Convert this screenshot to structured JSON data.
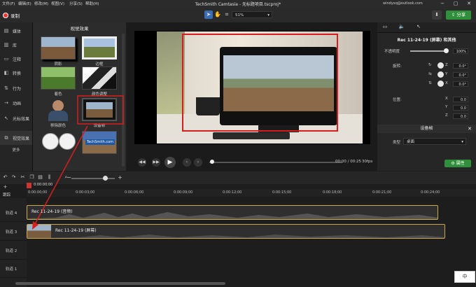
{
  "menu": [
    "文件(F)",
    "编辑(E)",
    "修改(M)",
    "视图(V)",
    "分享(S)",
    "帮助(H)"
  ],
  "app_title": "TechSmith Camtasia - 无标题项目.tscproj*",
  "account": "windyxq@outlook.com",
  "window_controls": [
    "−",
    "▢",
    "✕"
  ],
  "toolbar": {
    "record_label": "录制",
    "zoom_value": "51%",
    "share_label": "分享",
    "download_icon": "download-icon"
  },
  "sidebar": {
    "items": [
      {
        "icon": "film-icon",
        "label": "媒体"
      },
      {
        "icon": "library-icon",
        "label": "库"
      },
      {
        "icon": "annotation-icon",
        "label": "注释"
      },
      {
        "icon": "transition-icon",
        "label": "转换"
      },
      {
        "icon": "behavior-icon",
        "label": "行为"
      },
      {
        "icon": "animation-icon",
        "label": "动画"
      },
      {
        "icon": "cursor-effect-icon",
        "label": "光标效果"
      },
      {
        "icon": "visual-effects-icon",
        "label": "视觉效果"
      }
    ],
    "more": "更多"
  },
  "effects_panel": {
    "title": "视觉效果",
    "tiles": [
      {
        "label": "阴影"
      },
      {
        "label": "边框"
      },
      {
        "label": "着色"
      },
      {
        "label": "颜色调整"
      },
      {
        "label": "移除颜色"
      },
      {
        "label": "设备帧"
      },
      {
        "label": ""
      },
      {
        "label": ""
      }
    ],
    "techsmith_badge": "TechSmith.com"
  },
  "player": {
    "timecode": "00:00 / 00:25",
    "fps": "30fps"
  },
  "properties": {
    "clip_name": "Rec 11-24-19 (屏幕) 和其他",
    "opacity_label": "不透明度",
    "opacity_value": "100%",
    "rotation_label": "旋转:",
    "rotation": [
      {
        "axis": "Z",
        "value": "0.0°"
      },
      {
        "axis": "Y",
        "value": "0.0°"
      },
      {
        "axis": "X",
        "value": "0.0°"
      }
    ],
    "position_label": "位置:",
    "position": [
      {
        "axis": "X",
        "value": "0.0"
      },
      {
        "axis": "Y",
        "value": "0.0"
      },
      {
        "axis": "Z",
        "value": "0.0"
      }
    ],
    "device_frame_header": "设备帧",
    "type_label": "类型",
    "type_value": "桌面",
    "properties_button": "属性"
  },
  "timeline": {
    "playhead_time": "0:00:00;00",
    "track_header": "跟踪",
    "ticks": [
      "0:00:00;00",
      "0:00:03;00",
      "0:00:06;00",
      "0:00:09;00",
      "0:00:12;00",
      "0:00:15;00",
      "0:00:18;00",
      "0:00:21;00",
      "0:00:24;00"
    ],
    "tracks": [
      {
        "label": "轨道 4",
        "clip": "Rec 11-24-19 (音频)"
      },
      {
        "label": "轨道 3",
        "clip": "Rec 11-24-19 (屏幕)"
      },
      {
        "label": "轨道 2",
        "clip": ""
      },
      {
        "label": "轨道 1",
        "clip": ""
      }
    ]
  },
  "ime_badge": "中"
}
